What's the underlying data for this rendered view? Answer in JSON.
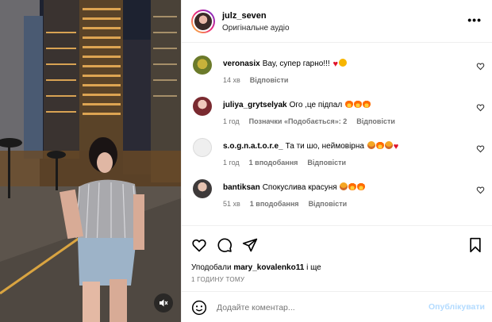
{
  "post": {
    "username": "julz_seven",
    "audio": "Оригінальне аудіо",
    "more_label": "•••"
  },
  "comments": [
    {
      "user": "veronasix",
      "text": "Вау, супер гарно!!!",
      "emojis": [
        "heart",
        "smile"
      ],
      "time": "14 хв",
      "meta": [],
      "reply": "Відповісти"
    },
    {
      "user": "juliya_grytselyak",
      "text": "Ого ,це підпал",
      "emojis": [
        "fire",
        "fire",
        "fire"
      ],
      "time": "1 год",
      "meta": [
        "Позначки «Подобається»: 2"
      ],
      "reply": "Відповісти"
    },
    {
      "user": "s.o.g.n.a.t.o.r.e_",
      "text": "Та ти шо, неймовірна",
      "emojis": [
        "grin",
        "fire",
        "grin",
        "heart"
      ],
      "time": "1 год",
      "meta": [
        "1 вподобання"
      ],
      "reply": "Відповісти"
    },
    {
      "user": "bantiksan",
      "text": "Спокуслива красуня",
      "emojis": [
        "grin",
        "fire",
        "fire"
      ],
      "time": "51 хв",
      "meta": [
        "1 вподобання"
      ],
      "reply": "Відповісти"
    }
  ],
  "likes": {
    "prefix": "Уподобали",
    "user": "mary_kovalenko11",
    "suffix": "і ще"
  },
  "timestamp": "1 ГОДИНУ ТОМУ",
  "add_comment": {
    "placeholder": "Додайте коментар...",
    "post_label": "Опублікувати"
  },
  "colors": {
    "accent_disabled": "#b3dbff",
    "muted": "#737373",
    "heart_emoji": "#e0132b"
  }
}
